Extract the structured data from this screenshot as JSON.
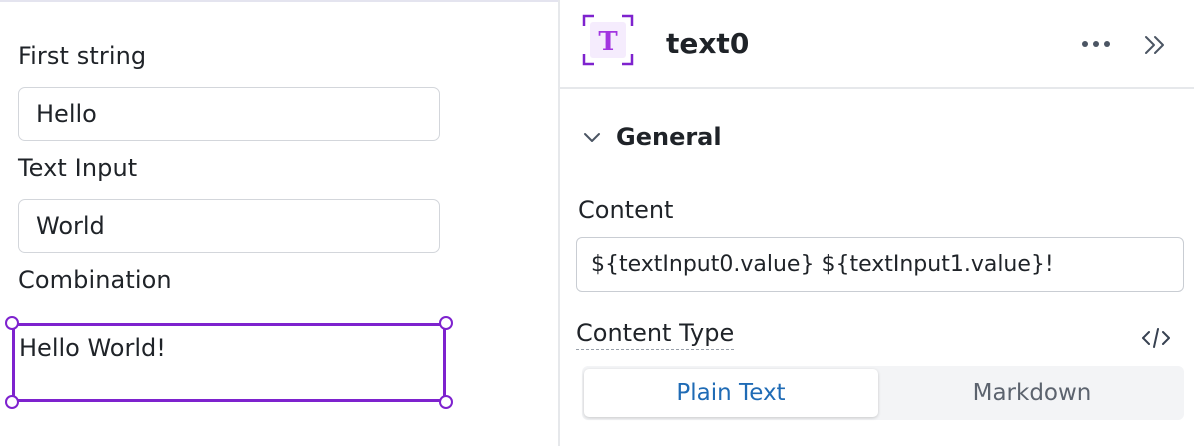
{
  "canvas": {
    "first_string_label": "First string",
    "first_string_value": "Hello",
    "text_input_label": "Text Input",
    "text_input_value": "World",
    "combination_label": "Combination",
    "combination_text": "Hello World!"
  },
  "inspector": {
    "component_icon_letter": "T",
    "component_name": "text0",
    "section_title": "General",
    "content_label": "Content",
    "content_value": "${textInput0.value} ${textInput1.value}!",
    "content_type_label": "Content Type",
    "content_type_options": [
      "Plain Text",
      "Markdown"
    ],
    "content_type_selected": "Plain Text"
  },
  "colors": {
    "selection": "#7e22ce",
    "active_tab_text": "#1f6bb5"
  },
  "icons": [
    "more-horizontal-icon",
    "collapse-panel-icon",
    "chevron-down-icon",
    "code-icon",
    "text-component-icon"
  ]
}
